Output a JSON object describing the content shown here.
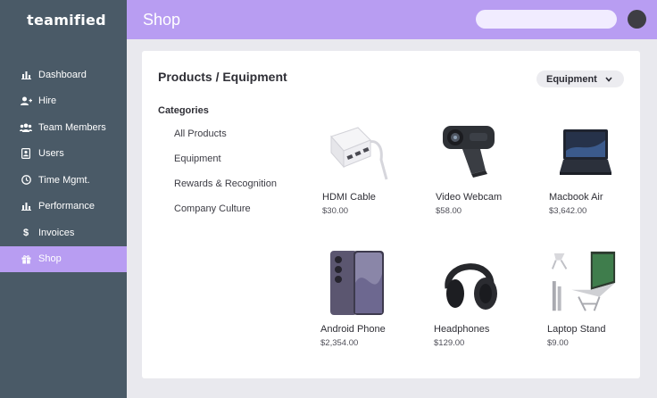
{
  "brand": "teamified",
  "sidebar": {
    "items": [
      {
        "label": "Dashboard",
        "icon": "chart-icon"
      },
      {
        "label": "Hire",
        "icon": "user-plus-icon"
      },
      {
        "label": "Team Members",
        "icon": "users-icon"
      },
      {
        "label": "Users",
        "icon": "id-card-icon"
      },
      {
        "label": "Time Mgmt.",
        "icon": "clock-icon"
      },
      {
        "label": "Performance",
        "icon": "chart-icon"
      },
      {
        "label": "Invoices",
        "icon": "dollar-icon"
      },
      {
        "label": "Shop",
        "icon": "gift-icon",
        "active": true
      }
    ]
  },
  "header": {
    "title": "Shop",
    "search_placeholder": ""
  },
  "main": {
    "breadcrumb": "Products / Equipment",
    "filter": {
      "selected": "Equipment"
    },
    "categories": {
      "title": "Categories",
      "items": [
        "All Products",
        "Equipment",
        "Rewards & Recognition",
        "Company Culture"
      ]
    },
    "products": [
      {
        "name": "HDMI Cable",
        "price": "$30.00"
      },
      {
        "name": "Video Webcam",
        "price": "$58.00"
      },
      {
        "name": "Macbook Air",
        "price": "$3,642.00"
      },
      {
        "name": "Android Phone",
        "price": "$2,354.00"
      },
      {
        "name": "Headphones",
        "price": "$129.00"
      },
      {
        "name": "Laptop Stand",
        "price": "$9.00"
      }
    ]
  },
  "colors": {
    "sidebar": "#4a5a67",
    "accent": "#b89df2",
    "background": "#e9e9ee"
  }
}
